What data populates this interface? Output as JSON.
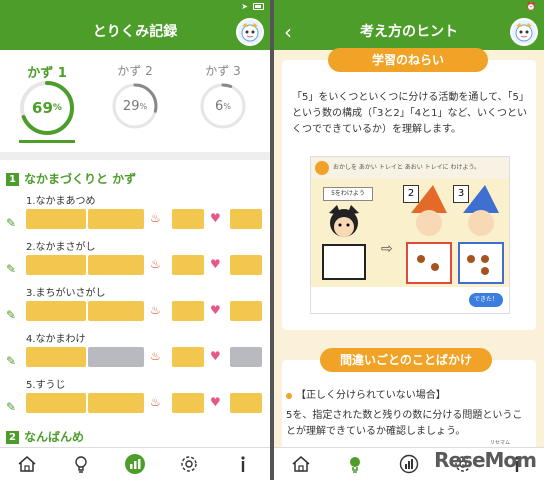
{
  "left": {
    "title": "とりくみ記録",
    "kazu": [
      {
        "label": "かず 1",
        "percent": "69",
        "unit": "%",
        "progress": 0.69
      },
      {
        "label": "かず 2",
        "percent": "29",
        "unit": "%",
        "progress": 0.29
      },
      {
        "label": "かず 3",
        "percent": "6",
        "unit": "%",
        "progress": 0.06
      }
    ],
    "sections": [
      {
        "num": "1",
        "title": "なかまづくりと かず"
      },
      {
        "num": "2",
        "title": "なんばんめ"
      }
    ],
    "rows": [
      {
        "title": "1.なかまあつめ",
        "cells": [
          "y",
          "y",
          "y",
          "y"
        ]
      },
      {
        "title": "2.なかまさがし",
        "cells": [
          "y",
          "y",
          "y",
          "y"
        ]
      },
      {
        "title": "3.まちがいさがし",
        "cells": [
          "y",
          "y",
          "y",
          "y"
        ]
      },
      {
        "title": "4.なかまわけ",
        "cells": [
          "y",
          "g",
          "y",
          "g"
        ]
      },
      {
        "title": "5.すうじ",
        "cells": [
          "y",
          "y",
          "y",
          "y"
        ]
      }
    ],
    "colors": {
      "green": "#4d9d2b",
      "yellow": "#f2c74e",
      "gray": "#b9b9c0",
      "track": "#e6e6e6"
    }
  },
  "right": {
    "title": "考え方のヒント",
    "aim_label": "学習のねらい",
    "aim_text": "「5」をいくつといくつに分ける活動を通して、「5」という数の構成（「3と2」「4と1」など、いくつといくつでできているか）を理解します。",
    "illus": {
      "instruction": "おかしを あかい トレイと あおい トレイに わけよう。",
      "card_label": "5をわけよう",
      "num_red": "2",
      "num_blue": "3",
      "done": "できた！"
    },
    "mistake_label": "間違いごとのことばかけ",
    "case_title": "【正しく分けられていない場合】",
    "case_text": "5を、指定された数と残りの数に分ける問題ということが理解できているか確認しましょう。"
  },
  "watermark": {
    "text": "ReseMom",
    "sub": "リセマム"
  }
}
